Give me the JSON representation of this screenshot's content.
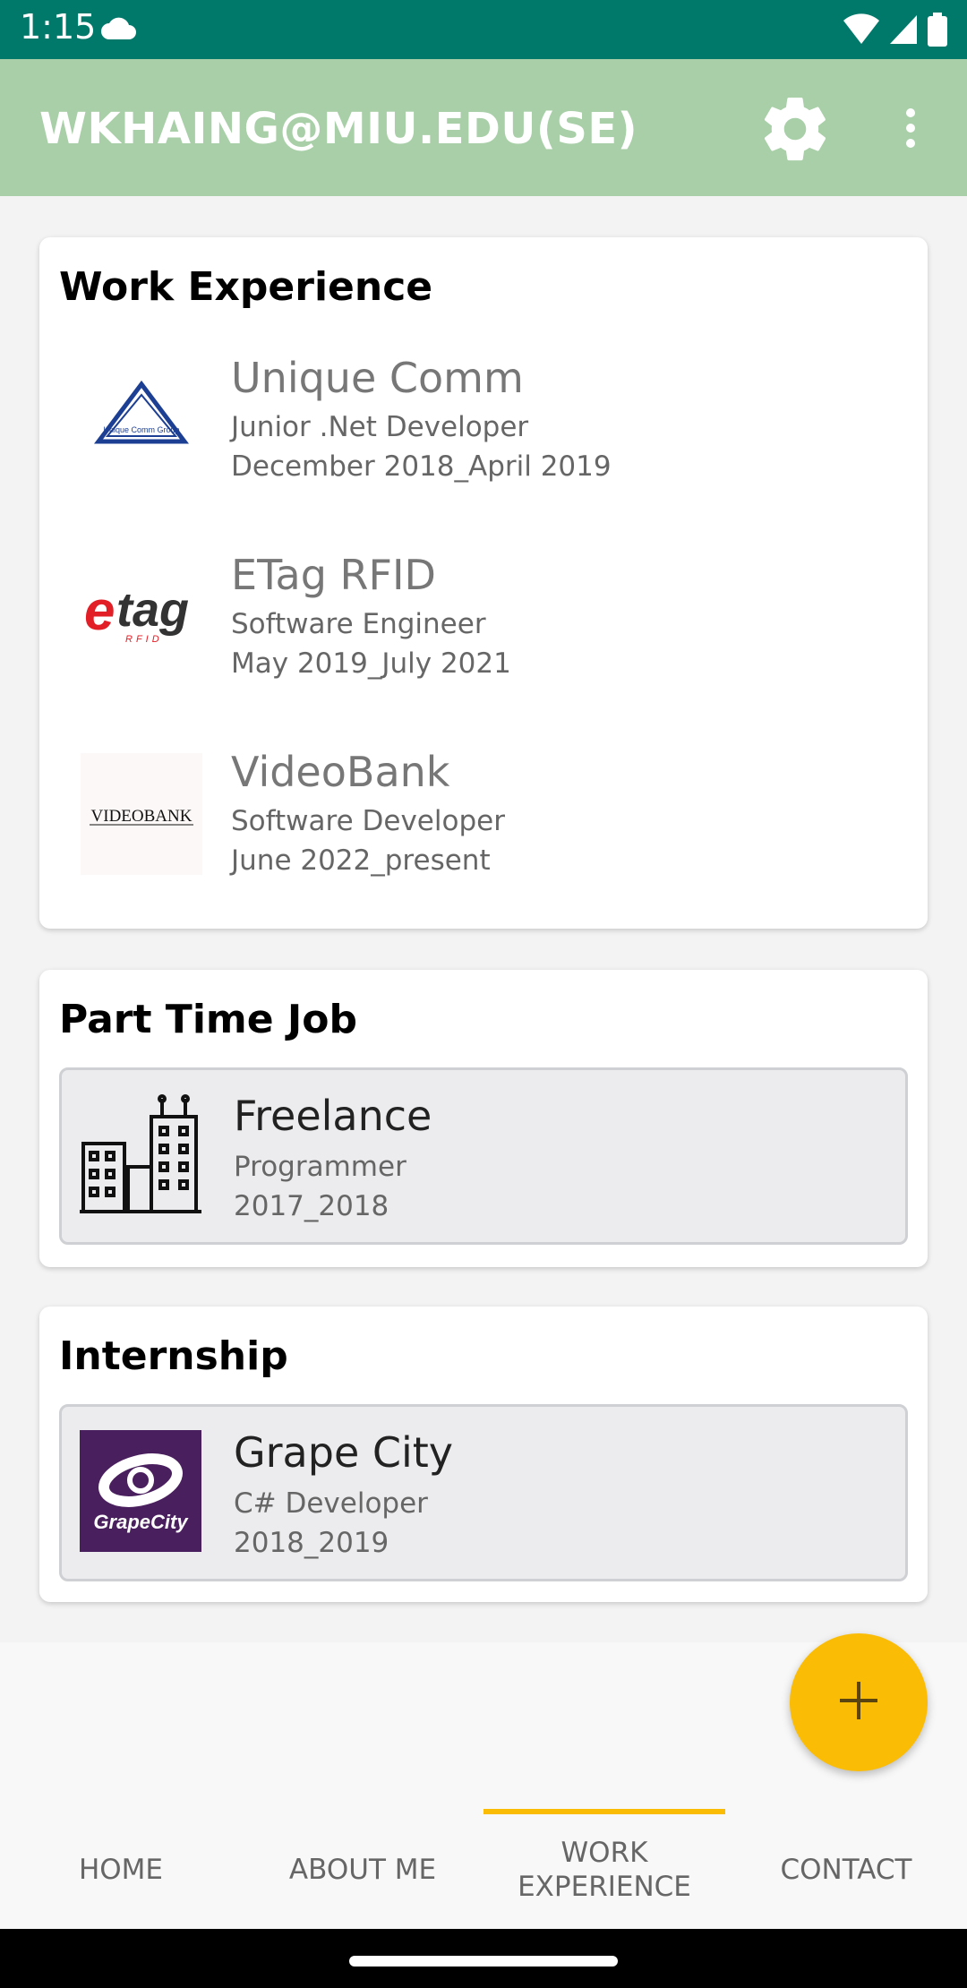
{
  "status_bar": {
    "time": "1:15"
  },
  "app_bar": {
    "title": "WKHAING@MIU.EDU(SE)"
  },
  "work_experience": {
    "heading": "Work Experience",
    "items": [
      {
        "company": "Unique Comm",
        "role": "Junior .Net Developer",
        "period": "December 2018_April 2019",
        "logo_text": "Unique Comm Group"
      },
      {
        "company": "ETag RFID",
        "role": "Software Engineer",
        "period": "May 2019_July 2021",
        "logo_text": "etag RFID"
      },
      {
        "company": "VideoBank",
        "role": "Software Developer",
        "period": "June 2022_present",
        "logo_text": "VIDEOBANK"
      }
    ]
  },
  "part_time": {
    "heading": "Part Time Job",
    "items": [
      {
        "company": "Freelance",
        "role": "Programmer",
        "period": "2017_2018"
      }
    ]
  },
  "internship": {
    "heading": "Internship",
    "items": [
      {
        "company": "Grape City",
        "role": "C# Developer",
        "period": "2018_2019",
        "logo_text": "GrapeCity"
      }
    ]
  },
  "tabs": [
    {
      "label": "HOME"
    },
    {
      "label": "ABOUT ME"
    },
    {
      "label": "WORK\nEXPERIENCE",
      "selected": true
    },
    {
      "label": "CONTACT"
    }
  ],
  "icons": {
    "status": [
      "cloud-icon",
      "wifi-icon",
      "signal-icon",
      "battery-icon"
    ],
    "app_bar": [
      "gear-icon",
      "more-vert-icon"
    ],
    "fab": "plus-icon",
    "freelance": "buildings-icon"
  },
  "colors": {
    "status_bar": "#00796b",
    "app_bar": "#a8cfa7",
    "accent": "#fbbc05",
    "grapecity": "#4a1f5e"
  }
}
